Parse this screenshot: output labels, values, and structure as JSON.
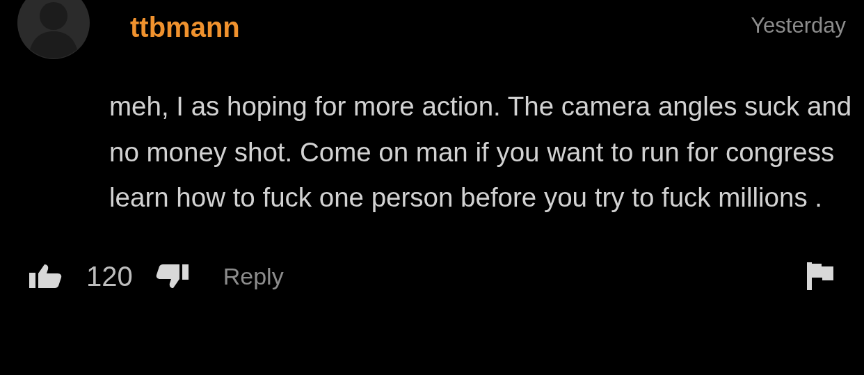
{
  "comment": {
    "username": "ttbmann",
    "time": "Yesterday",
    "text": "meh, I as hoping for more action. The camera angles suck and no money shot. Come on man if you want to run for congress learn how to fuck one person before you try to fuck millions .",
    "likes": "120",
    "reply": "Reply"
  }
}
